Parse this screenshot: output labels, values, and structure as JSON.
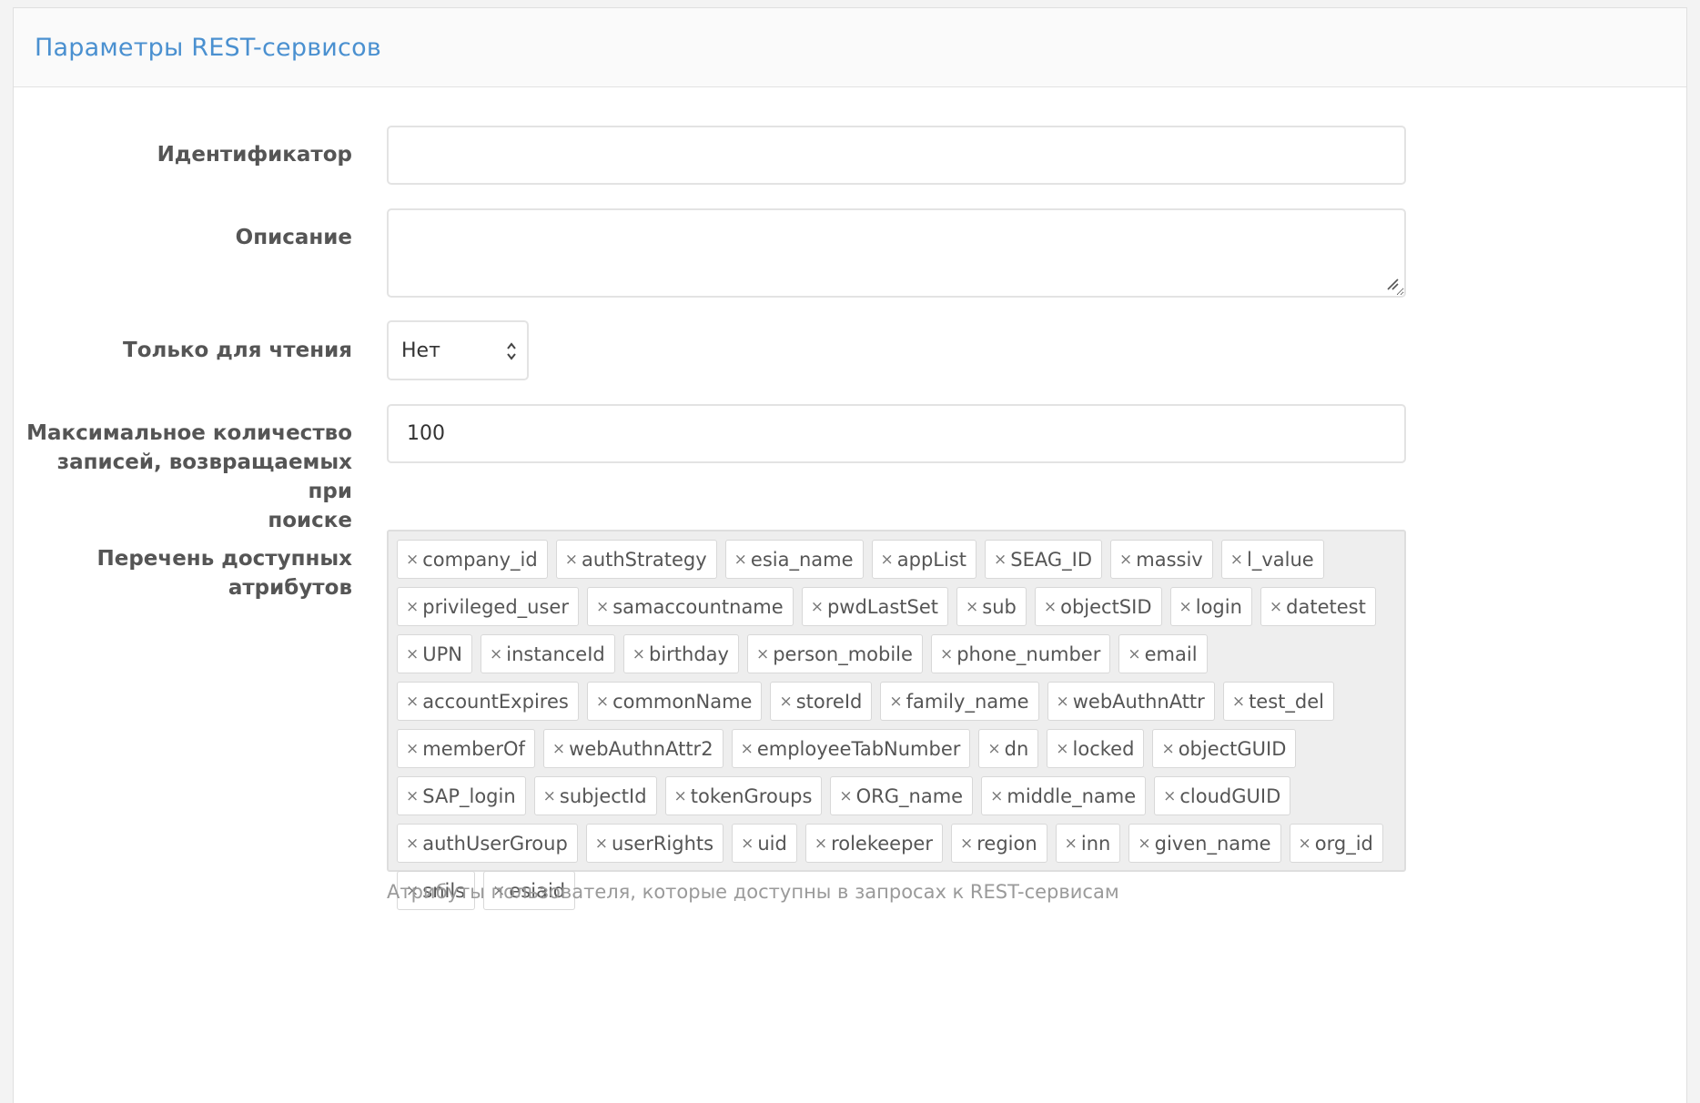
{
  "panel": {
    "title": "Параметры REST-сервисов"
  },
  "form": {
    "identifier": {
      "label": "Идентификатор",
      "value": "",
      "placeholder": ""
    },
    "description": {
      "label": "Описание",
      "value": ""
    },
    "readonly": {
      "label": "Только для чтения",
      "selected": "Нет"
    },
    "max_records": {
      "label_lines": [
        "Максимальное количество",
        "записей, возвращаемых при",
        "поиске"
      ],
      "value": "100"
    },
    "attributes": {
      "label_lines": [
        "Перечень доступных",
        "атрибутов"
      ],
      "remove_glyph": "×",
      "tags": [
        "company_id",
        "authStrategy",
        "esia_name",
        "appList",
        "SEAG_ID",
        "massiv",
        "l_value",
        "privileged_user",
        "samaccountname",
        "pwdLastSet",
        "sub",
        "objectSID",
        "login",
        "datetest",
        "UPN",
        "instanceId",
        "birthday",
        "person_mobile",
        "phone_number",
        "email",
        "accountExpires",
        "commonName",
        "storeId",
        "family_name",
        "webAuthnAttr",
        "test_del",
        "memberOf",
        "webAuthnAttr2",
        "employeeTabNumber",
        "dn",
        "locked",
        "objectGUID",
        "SAP_login",
        "subjectId",
        "tokenGroups",
        "ORG_name",
        "middle_name",
        "cloudGUID",
        "authUserGroup",
        "userRights",
        "uid",
        "rolekeeper",
        "region",
        "inn",
        "given_name",
        "org_id",
        "snils",
        "esiaid"
      ],
      "help": "Атрибуты пользователя, которые доступны в запросах к REST-сервисам"
    }
  },
  "colors": {
    "title": "#4a90d0",
    "label": "#555555",
    "tag_bg": "#ffffff",
    "tags_area_bg": "#eeeeee"
  }
}
